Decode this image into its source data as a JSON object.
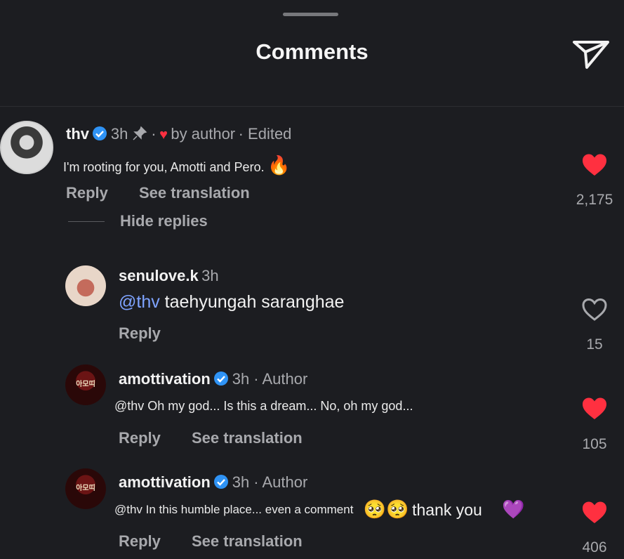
{
  "header": {
    "title": "Comments"
  },
  "icons": {
    "send": "send-icon",
    "like": "heart-icon",
    "verified": "verified-badge-icon",
    "pin": "pin-icon"
  },
  "colors": {
    "background": "#1c1d21",
    "like_red": "#ff3040",
    "verified_blue": "#2f93f5",
    "mention": "#7ea3ff",
    "secondary_text": "#a8a9ad"
  },
  "comments": [
    {
      "username": "thv",
      "time": "3h",
      "separator": "·",
      "liked_by": "by author",
      "edited": "· Edited",
      "text": "I'm rooting for you, Amotti and Pero.",
      "emoji": "🔥",
      "reply_label": "Reply",
      "translate_label": "See translation",
      "likes": "2,175",
      "hide_replies_label": "Hide replies"
    },
    {
      "username": "senulove.k",
      "time": "3h",
      "mention": "@thv",
      "text": " taehyungah saranghae",
      "reply_label": "Reply",
      "likes": "15"
    },
    {
      "username": "amottivation",
      "time": "3h · Author",
      "avatar_text": "아모띠",
      "text": "@thv Oh my god... Is this a dream... No, oh my god...",
      "reply_label": "Reply",
      "translate_label": "See translation",
      "likes": "105"
    },
    {
      "username": "amottivation",
      "time": "3h · Author",
      "avatar_text": "아모띠",
      "text": "@thv In this humble place... even a comment",
      "emoji_a": "🥺🥺",
      "text_b": "thank you",
      "emoji_b": "💜",
      "reply_label": "Reply",
      "translate_label": "See translation",
      "likes": "406"
    }
  ]
}
